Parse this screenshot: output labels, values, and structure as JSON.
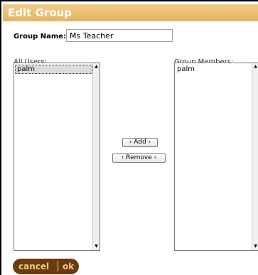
{
  "dialog": {
    "title": "Edit Group"
  },
  "group_name": {
    "label": "Group Name:",
    "value": "Ms Teacher"
  },
  "all_users": {
    "label": "All Users:",
    "items": [
      {
        "label": "palm",
        "selected": true
      }
    ]
  },
  "group_members": {
    "label": "Group Members:",
    "items": [
      {
        "label": "palm",
        "selected": false
      }
    ]
  },
  "buttons": {
    "add_label": "› Add ›",
    "remove_label": "‹ Remove ‹",
    "cancel_label": "cancel",
    "ok_label": "ok"
  },
  "icons": {
    "scroll_up": "up-arrow-icon",
    "scroll_down": "down-arrow-icon"
  },
  "colors": {
    "title_bar": "#e4b463",
    "pill_bg": "#6b3b10",
    "pill_text": "#f0c878"
  }
}
